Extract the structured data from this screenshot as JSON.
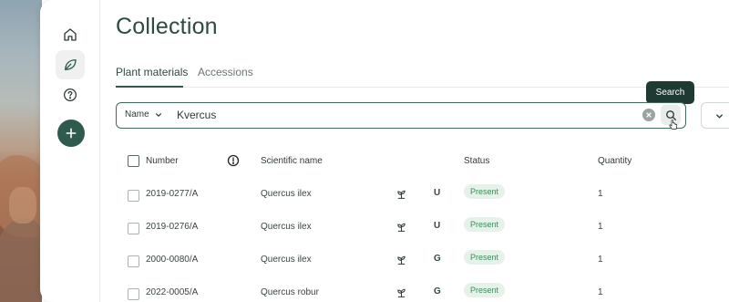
{
  "nav": {
    "home_icon": "home-icon",
    "plants_icon": "leaf-icon",
    "help_icon": "help-icon",
    "add_icon": "plus-icon"
  },
  "page": {
    "title": "Collection"
  },
  "tabs": [
    {
      "label": "Plant materials",
      "active": true
    },
    {
      "label": "Accessions",
      "active": false
    }
  ],
  "search": {
    "field_label": "Name",
    "value": "Kvercus",
    "tooltip": "Search"
  },
  "table": {
    "columns": {
      "number": "Number",
      "scientific_name": "Scientific name",
      "status": "Status",
      "quantity": "Quantity"
    },
    "rows": [
      {
        "number": "2019-0277/A",
        "scientific_name": "Quercus ilex",
        "provenance": "U",
        "status": "Present",
        "quantity": "1"
      },
      {
        "number": "2019-0276/A",
        "scientific_name": "Quercus ilex",
        "provenance": "U",
        "status": "Present",
        "quantity": "1"
      },
      {
        "number": "2000-0080/A",
        "scientific_name": "Quercus ilex",
        "provenance": "G",
        "status": "Present",
        "quantity": "1"
      },
      {
        "number": "2022-0005/A",
        "scientific_name": "Quercus robur",
        "provenance": "G",
        "status": "Present",
        "quantity": "1"
      }
    ]
  },
  "colors": {
    "accent": "#2f5b4f",
    "title": "#2f4a43",
    "badge_bg": "#e6f2e9",
    "badge_text": "#3e8a5c",
    "tooltip_bg": "#1f3a33"
  }
}
